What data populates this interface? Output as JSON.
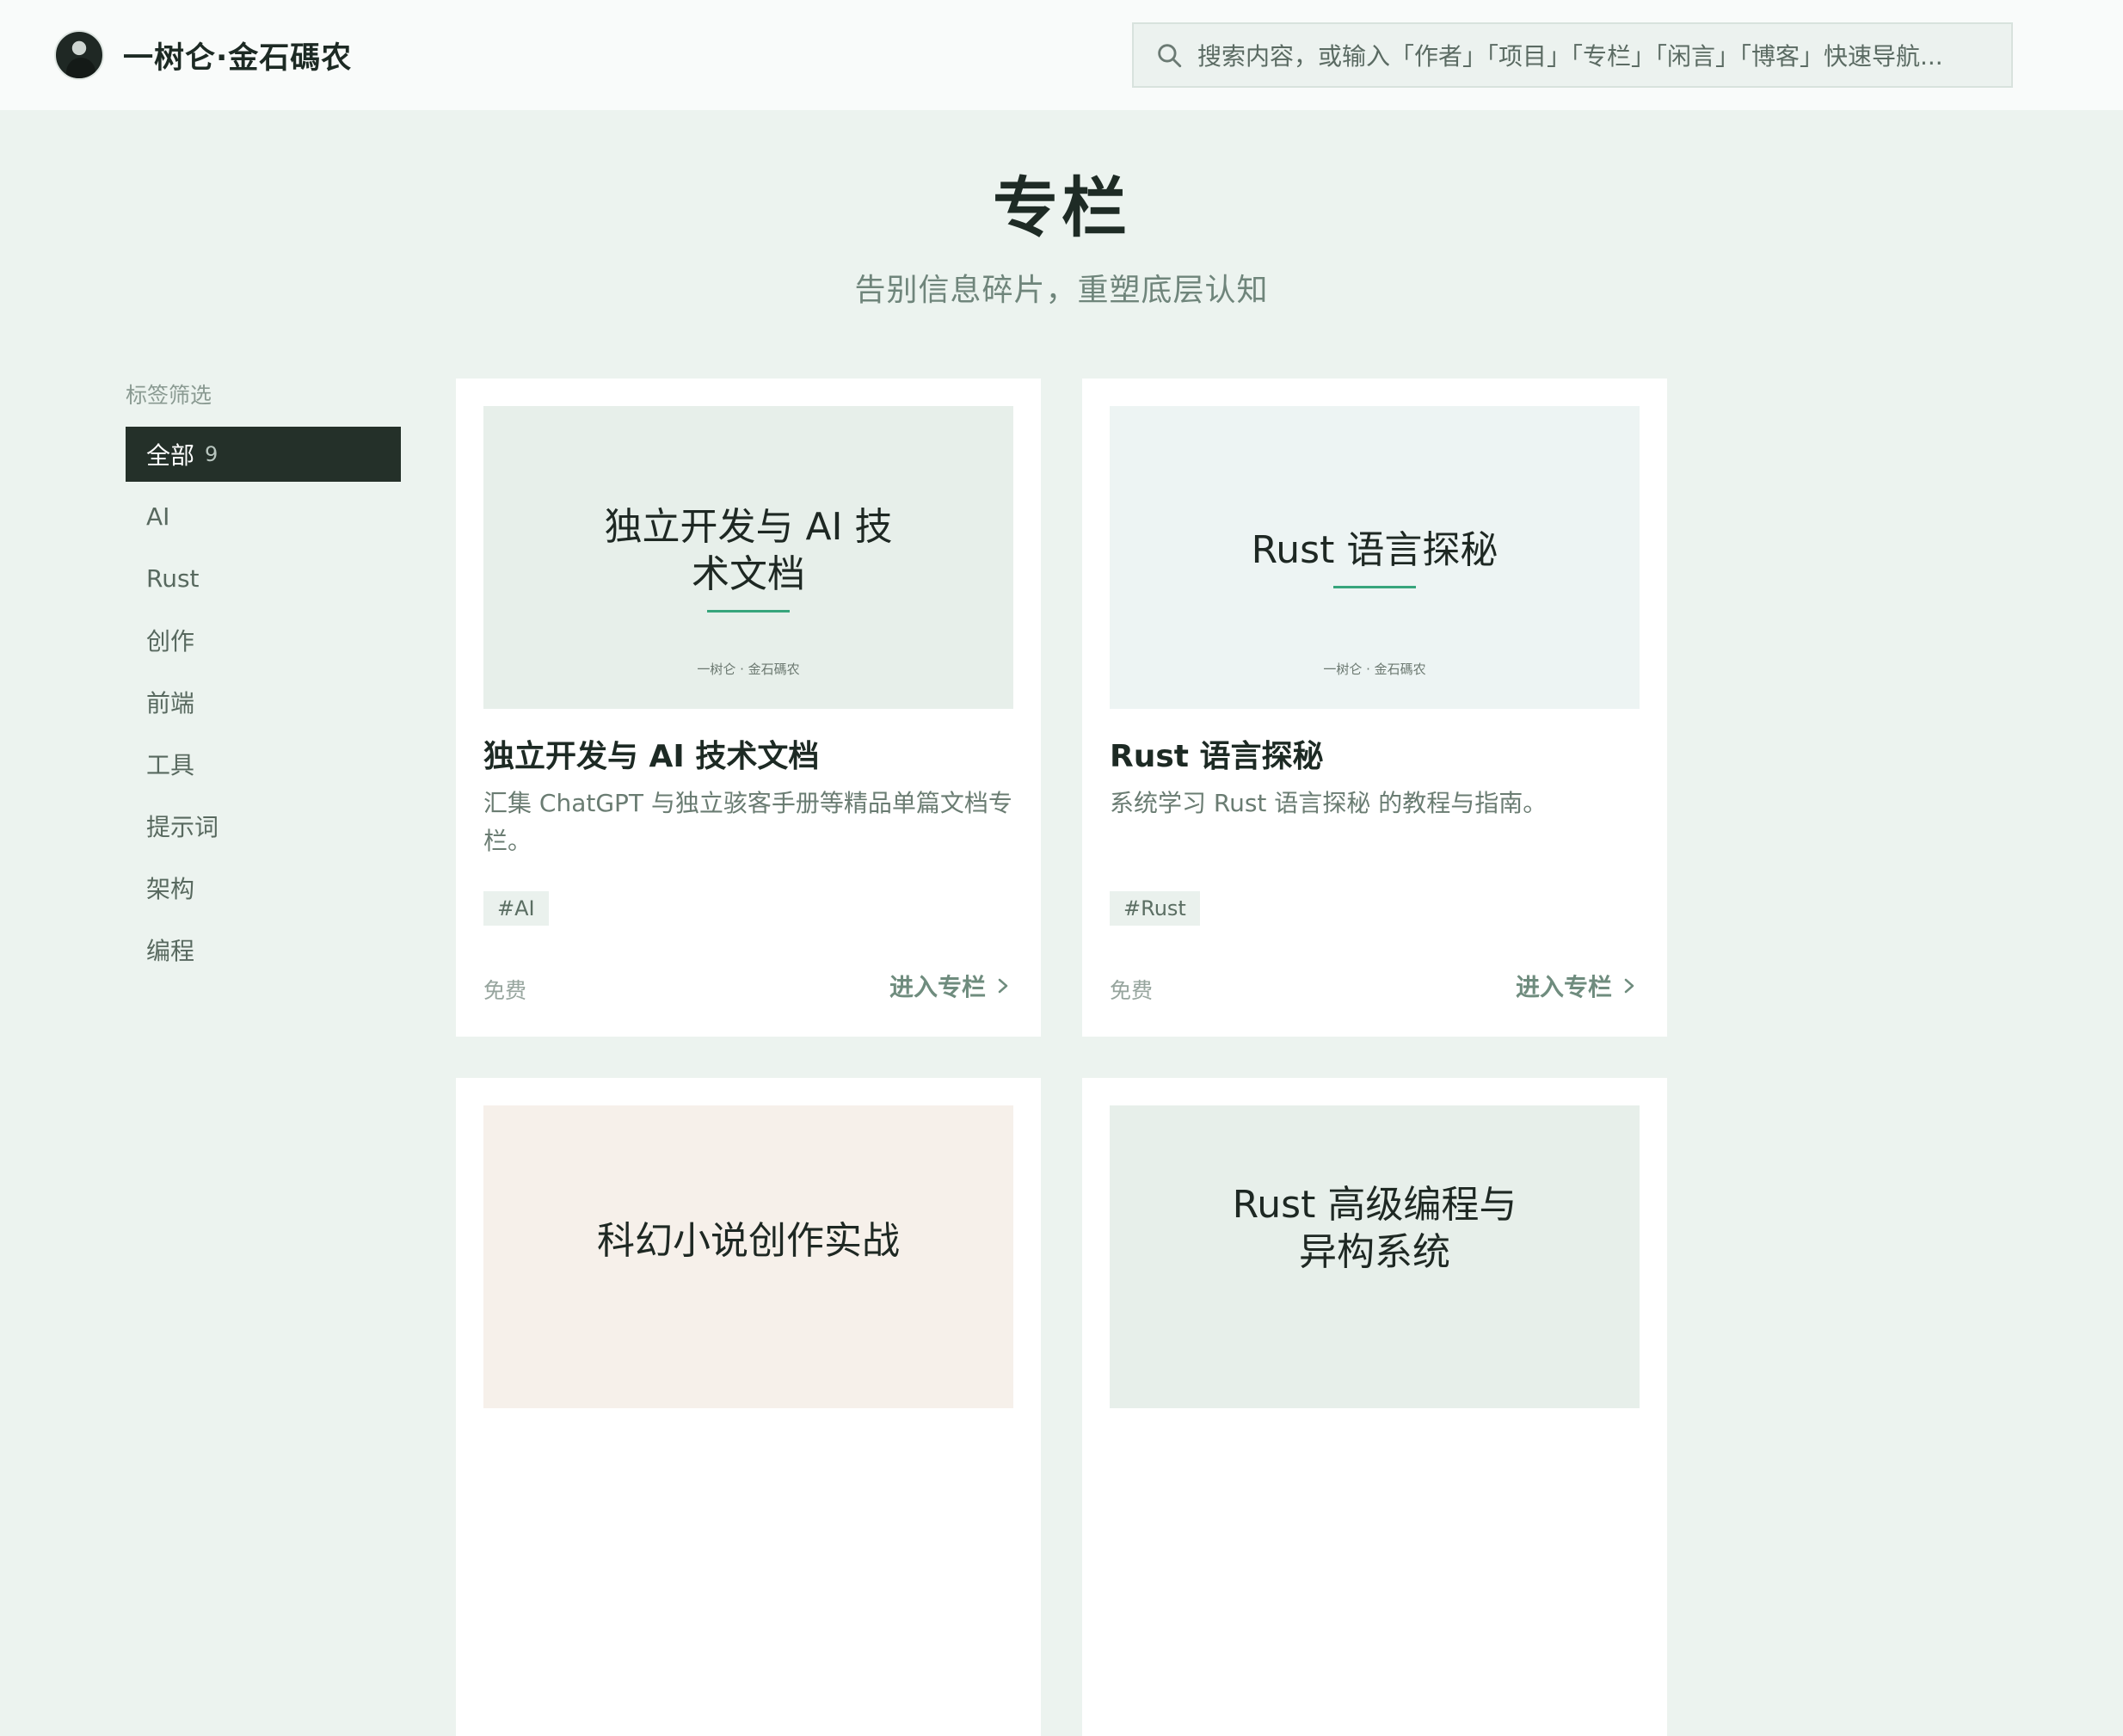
{
  "header": {
    "brand_name": "一树仑·金石碼农",
    "search_placeholder": "搜索内容，或输入「作者」「项目」「专栏」「闲言」「博客」快速导航..."
  },
  "page": {
    "title": "专栏",
    "subtitle": "告别信息碎片，重塑底层认知"
  },
  "sidebar": {
    "heading": "标签筛选",
    "tags": [
      {
        "label": "全部",
        "count": "9"
      },
      {
        "label": "AI"
      },
      {
        "label": "Rust"
      },
      {
        "label": "创作"
      },
      {
        "label": "前端"
      },
      {
        "label": "工具"
      },
      {
        "label": "提示词"
      },
      {
        "label": "架构"
      },
      {
        "label": "编程"
      }
    ]
  },
  "cards": [
    {
      "cover_title": "独立开发与 AI 技术文档",
      "cover_author": "一树仑 · 金石碼农",
      "cover_color": "#e7efea",
      "title": "独立开发与 AI 技术文档",
      "desc": "汇集 ChatGPT 与独立骇客手册等精品单篇文档专栏。",
      "tag": "#AI",
      "price": "免费",
      "enter": "进入专栏"
    },
    {
      "cover_title": "Rust 语言探秘",
      "cover_author": "一树仑 · 金石碼农",
      "cover_color": "#edf4f3",
      "title": "Rust 语言探秘",
      "desc": "系统学习 Rust 语言探秘 的教程与指南。",
      "tag": "#Rust",
      "price": "免费",
      "enter": "进入专栏"
    },
    {
      "cover_title": "科幻小说创作实战",
      "cover_color": "#f6f0ea"
    },
    {
      "cover_title": "Rust 高级编程与异构系统",
      "cover_color": "#e7efea"
    }
  ],
  "colors": {
    "background": "#ecf3ef",
    "accent": "#37a57c",
    "active_tag_bg": "#243029"
  }
}
